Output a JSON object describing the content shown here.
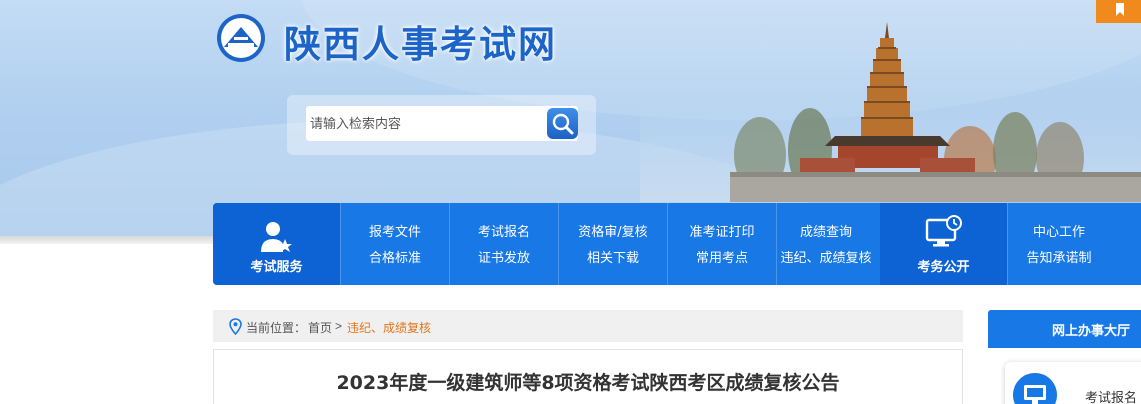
{
  "header": {
    "site_title": "陕西人事考试网",
    "search": {
      "placeholder": "请输入检索内容"
    }
  },
  "nav": {
    "left_feature": {
      "label": "考试服务",
      "icon": "person-star-icon"
    },
    "columns": [
      {
        "top": "报考文件",
        "bottom": "合格标准"
      },
      {
        "top": "考试报名",
        "bottom": "证书发放"
      },
      {
        "top": "资格审/复核",
        "bottom": "相关下载"
      },
      {
        "top": "准考证打印",
        "bottom": "常用考点"
      },
      {
        "top": "成绩查询",
        "bottom": "违纪、成绩复核"
      }
    ],
    "right_feature": {
      "label": "考务公开",
      "icon": "monitor-clock-icon"
    },
    "extra_column": {
      "top": "中心工作",
      "bottom": "告知承诺制"
    }
  },
  "breadcrumb": {
    "prefix": "当前位置：",
    "home": "首页",
    "separator": ">",
    "current": "违纪、成绩复核"
  },
  "article": {
    "title": "2023年度一级建筑师等8项资格考试陕西考区成绩复核公告"
  },
  "sidebar": {
    "heading": "网上办事大厅",
    "card_label": "考试报名"
  },
  "colors": {
    "primary_blue": "#1878e6",
    "dark_blue": "#0d63d4",
    "accent_orange": "#e2761c",
    "bookmark_orange": "#f08a1c"
  }
}
